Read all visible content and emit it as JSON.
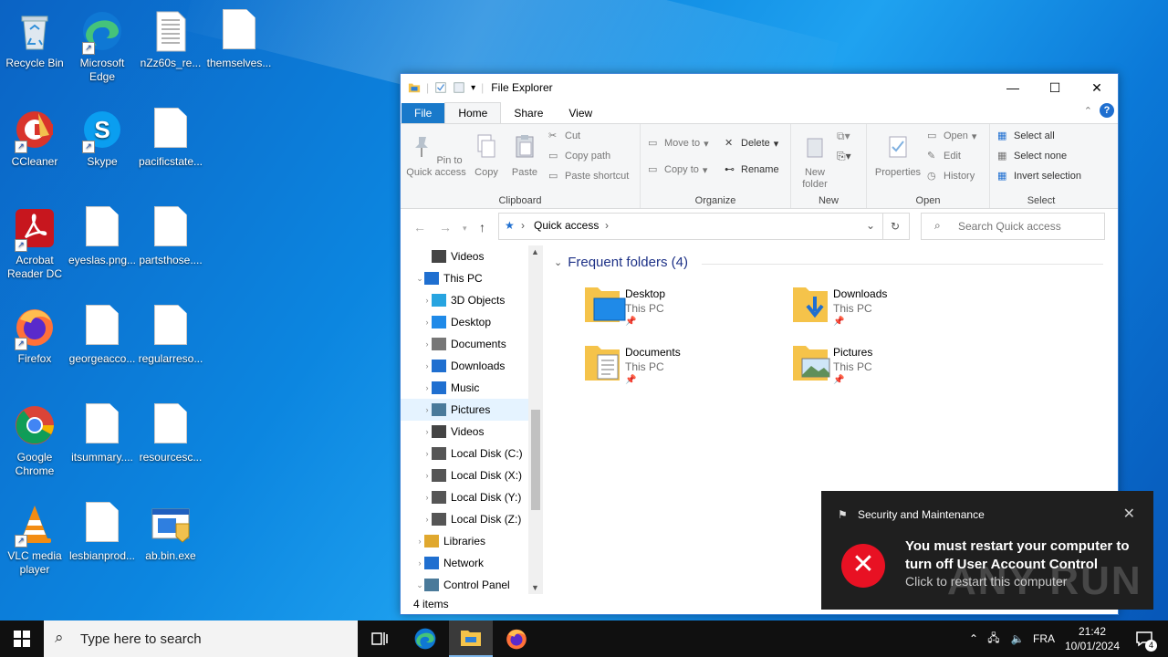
{
  "desktop": {
    "icons": [
      {
        "label": "Recycle Bin",
        "icon": "recycle-bin-icon"
      },
      {
        "label": "Microsoft Edge",
        "icon": "edge-icon"
      },
      {
        "label": "nZz60s_re...",
        "icon": "file-icon"
      },
      {
        "label": "themselves...",
        "icon": "file-icon"
      },
      {
        "label": "CCleaner",
        "icon": "ccleaner-icon"
      },
      {
        "label": "Skype",
        "icon": "skype-icon"
      },
      {
        "label": "pacificstate...",
        "icon": "file-icon"
      },
      {
        "label": "Acrobat Reader DC",
        "icon": "acrobat-icon"
      },
      {
        "label": "eyeslas.png...",
        "icon": "file-icon"
      },
      {
        "label": "partsthose....",
        "icon": "file-icon"
      },
      {
        "label": "Firefox",
        "icon": "firefox-icon"
      },
      {
        "label": "georgeacco...",
        "icon": "file-icon"
      },
      {
        "label": "regularreso...",
        "icon": "file-icon"
      },
      {
        "label": "Google Chrome",
        "icon": "chrome-icon"
      },
      {
        "label": "itsummary....",
        "icon": "file-icon"
      },
      {
        "label": "resourcesc...",
        "icon": "file-icon"
      },
      {
        "label": "VLC media player",
        "icon": "vlc-icon"
      },
      {
        "label": "lesbianprod...",
        "icon": "file-icon"
      },
      {
        "label": "ab.bin.exe",
        "icon": "exe-icon"
      }
    ]
  },
  "explorer": {
    "title": "File Explorer",
    "tabs": [
      "File",
      "Home",
      "Share",
      "View"
    ],
    "ribbon": {
      "clipboard": {
        "pin": "Pin to Quick access",
        "copy": "Copy",
        "paste": "Paste",
        "cut": "Cut",
        "copy_path": "Copy path",
        "paste_shortcut": "Paste shortcut",
        "group": "Clipboard"
      },
      "organize": {
        "move_to": "Move to",
        "copy_to": "Copy to",
        "delete": "Delete",
        "rename": "Rename",
        "group": "Organize"
      },
      "new": {
        "new_folder": "New folder",
        "group": "New"
      },
      "open": {
        "properties": "Properties",
        "open": "Open",
        "edit": "Edit",
        "history": "History",
        "group": "Open"
      },
      "select": {
        "select_all": "Select all",
        "select_none": "Select none",
        "invert": "Invert selection",
        "group": "Select"
      }
    },
    "address": {
      "location": "Quick access",
      "search_placeholder": "Search Quick access"
    },
    "nav": [
      {
        "label": "Videos",
        "indent": 1,
        "selected": false
      },
      {
        "label": "This PC",
        "indent": 0,
        "selected": false
      },
      {
        "label": "3D Objects",
        "indent": 1,
        "selected": false
      },
      {
        "label": "Desktop",
        "indent": 1,
        "selected": false
      },
      {
        "label": "Documents",
        "indent": 1,
        "selected": false
      },
      {
        "label": "Downloads",
        "indent": 1,
        "selected": false
      },
      {
        "label": "Music",
        "indent": 1,
        "selected": false
      },
      {
        "label": "Pictures",
        "indent": 1,
        "selected": true
      },
      {
        "label": "Videos",
        "indent": 1,
        "selected": false
      },
      {
        "label": "Local Disk (C:)",
        "indent": 1,
        "selected": false
      },
      {
        "label": "Local Disk (X:)",
        "indent": 1,
        "selected": false
      },
      {
        "label": "Local Disk (Y:)",
        "indent": 1,
        "selected": false
      },
      {
        "label": "Local Disk (Z:)",
        "indent": 1,
        "selected": false
      },
      {
        "label": "Libraries",
        "indent": 0,
        "selected": false
      },
      {
        "label": "Network",
        "indent": 0,
        "selected": false
      },
      {
        "label": "Control Panel",
        "indent": 0,
        "selected": false
      }
    ],
    "content": {
      "group_header": "Frequent folders (4)",
      "folders": [
        {
          "name": "Desktop",
          "location": "This PC"
        },
        {
          "name": "Downloads",
          "location": "This PC"
        },
        {
          "name": "Documents",
          "location": "This PC"
        },
        {
          "name": "Pictures",
          "location": "This PC"
        }
      ]
    },
    "status": "4 items"
  },
  "toast": {
    "app": "Security and Maintenance",
    "title": "You must restart your computer to turn off User Account Control",
    "body": "Click to restart this computer",
    "watermark": "ANY RUN"
  },
  "taskbar": {
    "search_placeholder": "Type here to search",
    "language": "FRA",
    "time": "21:42",
    "date": "10/01/2024",
    "notification_count": "4"
  }
}
